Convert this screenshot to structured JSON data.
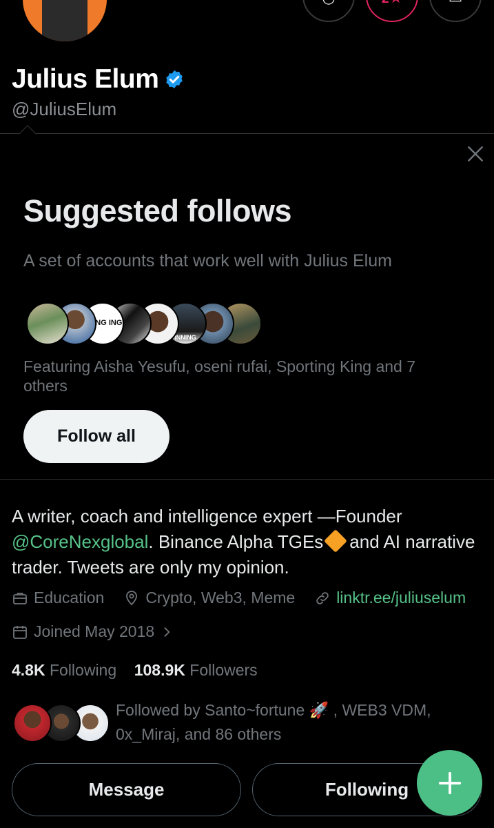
{
  "profile": {
    "name": "Julius Elum",
    "handle": "@JuliusElum",
    "avatar_color": "#ef7a2a"
  },
  "top_actions": [
    {
      "icon": "bell-icon"
    },
    {
      "icon": "star-icon"
    },
    {
      "icon": "more-icon"
    }
  ],
  "suggested": {
    "title": "Suggested follows",
    "subtitle": "A set of accounts that work well with Julius Elum",
    "featuring": "Featuring Aisha Yesufu, oseni rufai, Sporting King and 7 others",
    "follow_all_label": "Follow all",
    "sporting_king_text": "RTING ING",
    "winning_text": "INNING"
  },
  "bio": {
    "part1": "A writer, coach and intelligence expert —Founder",
    "mention": "@CoreNexglobal",
    "part2": ". Binance Alpha TGEs",
    "part3": "and AI narrative trader. Tweets are only my opinion."
  },
  "meta": {
    "category": "Education",
    "location": "Crypto, Web3, Meme",
    "link": "linktr.ee/juliuselum",
    "joined": "Joined May 2018"
  },
  "stats": {
    "following_count": "4.8K",
    "following_label": "Following",
    "followers_count": "108.9K",
    "followers_label": "Followers"
  },
  "followed_by": {
    "line1": "Followed by Santo~fortune 🚀 , WEB3 VDM,",
    "line2": "0x_Miraj, and 86 others"
  },
  "buttons": {
    "message": "Message",
    "following": "Following"
  },
  "colors": {
    "accent_green": "#56c288",
    "fab_green": "#4cbf86",
    "verified_blue": "#1d9bf0",
    "pink": "#e0245e"
  }
}
